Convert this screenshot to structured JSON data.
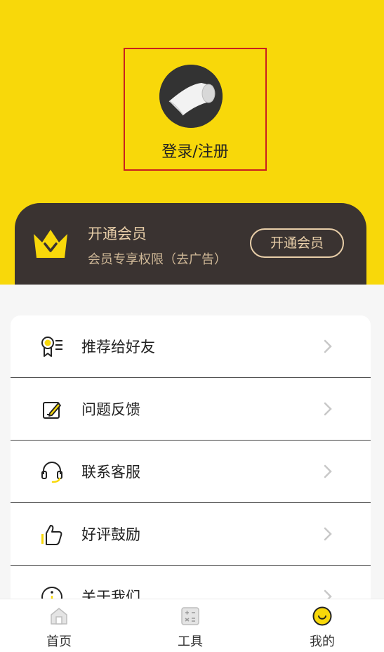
{
  "profile": {
    "login_label": "登录/注册",
    "avatar_icon": "pipe-elbow-avatar"
  },
  "vip": {
    "title": "开通会员",
    "subtitle": "会员专享权限（去广告）",
    "button_label": "开通会员",
    "icon": "crown-icon",
    "colors": {
      "card": "#3a3331",
      "accent": "#f8d80a",
      "text": "#e9cfa9"
    }
  },
  "menu": {
    "items": [
      {
        "label": "推荐给好友",
        "icon": "recommend-icon"
      },
      {
        "label": "问题反馈",
        "icon": "feedback-icon"
      },
      {
        "label": "联系客服",
        "icon": "headset-icon"
      },
      {
        "label": "好评鼓励",
        "icon": "thumbs-up-icon"
      },
      {
        "label": "关于我们",
        "icon": "info-icon"
      }
    ]
  },
  "tabbar": {
    "tabs": [
      {
        "label": "首页",
        "icon": "home-icon",
        "active": false
      },
      {
        "label": "工具",
        "icon": "calculator-icon",
        "active": false
      },
      {
        "label": "我的",
        "icon": "smile-icon",
        "active": true
      }
    ]
  },
  "theme": {
    "primary": "#f8d80a",
    "background": "#f6f6f6"
  }
}
